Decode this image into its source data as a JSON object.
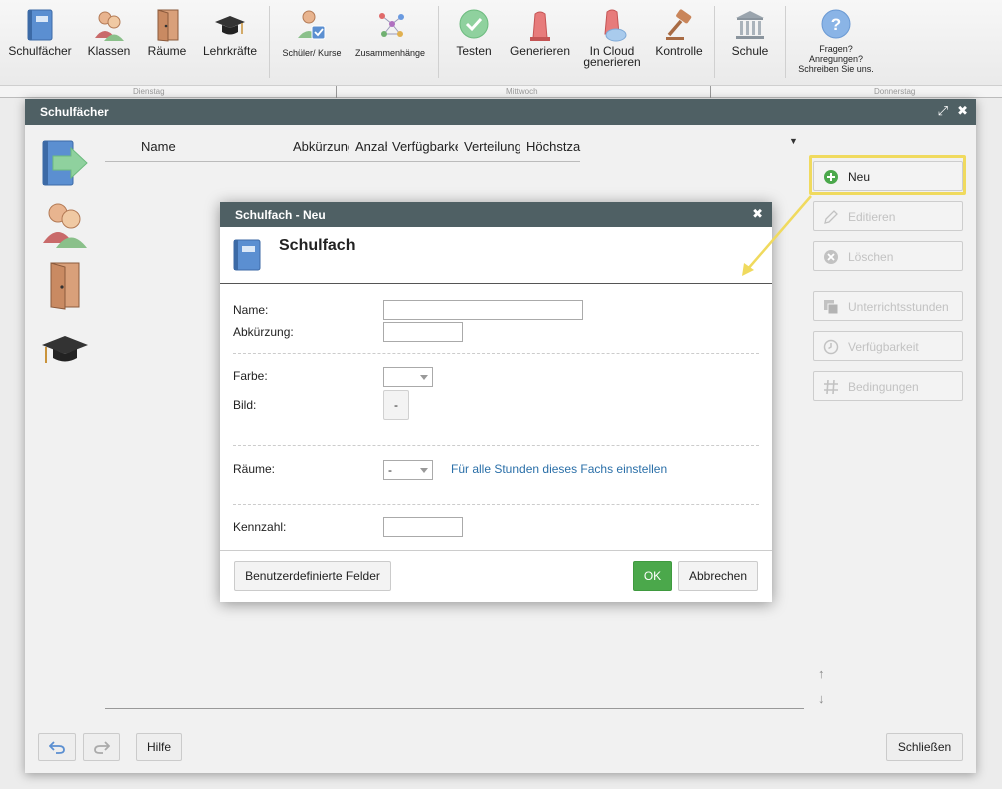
{
  "toolbar": {
    "items": [
      {
        "label": "Schulfächer",
        "icon": "book-icon"
      },
      {
        "label": "Klassen",
        "icon": "students-icon"
      },
      {
        "label": "Räume",
        "icon": "door-icon"
      },
      {
        "label": "Lehrkräfte",
        "icon": "graduation-cap-icon"
      },
      {
        "label": "Schüler/ Kurse",
        "icon": "student-check-icon"
      },
      {
        "label": "Zusammenhänge",
        "icon": "network-icon"
      },
      {
        "label": "Testen",
        "icon": "checkmark-badge-icon"
      },
      {
        "label": "Generieren",
        "icon": "siren-icon"
      },
      {
        "label": "In Cloud generieren",
        "icon": "cloud-siren-icon"
      },
      {
        "label": "Kontrolle",
        "icon": "gavel-icon"
      },
      {
        "label": "Schule",
        "icon": "building-icon"
      },
      {
        "label": "Fragen? Anregungen? Schreiben Sie uns.",
        "icon": "help-icon"
      }
    ]
  },
  "days": [
    "Dienstag",
    "Mittwoch",
    "Donnerstag"
  ],
  "dialog": {
    "title": "Schulfächer",
    "columns": [
      "Name",
      "Abkürzung",
      "Anzahl",
      "Verfügbarkeit",
      "Verteilung",
      "Höchstzahl"
    ],
    "side_buttons": [
      {
        "label": "Neu",
        "enabled": true
      },
      {
        "label": "Editieren",
        "enabled": false
      },
      {
        "label": "Löschen",
        "enabled": false
      },
      {
        "label": "Unterrichtsstunden",
        "enabled": false
      },
      {
        "label": "Verfügbarkeit",
        "enabled": false
      },
      {
        "label": "Bedingungen",
        "enabled": false
      }
    ],
    "footer": {
      "help": "Hilfe",
      "close": "Schließen"
    }
  },
  "modal": {
    "title": "Schulfach - Neu",
    "heading": "Schulfach",
    "fields": {
      "name_label": "Name:",
      "name_value": "",
      "abbr_label": "Abkürzung:",
      "abbr_value": "",
      "color_label": "Farbe:",
      "color_value": "",
      "image_label": "Bild:",
      "image_button": "-",
      "rooms_label": "Räume:",
      "rooms_value": "-",
      "rooms_link": "Für alle Stunden dieses Fachs einstellen",
      "number_label": "Kennzahl:",
      "number_value": ""
    },
    "buttons": {
      "custom": "Benutzerdefinierte Felder",
      "ok": "OK",
      "cancel": "Abbrechen"
    }
  },
  "colors": {
    "title_bar": "#4f6064",
    "ok_green": "#4ba84b",
    "highlight": "#f0da5e",
    "link": "#2a6fa8"
  }
}
